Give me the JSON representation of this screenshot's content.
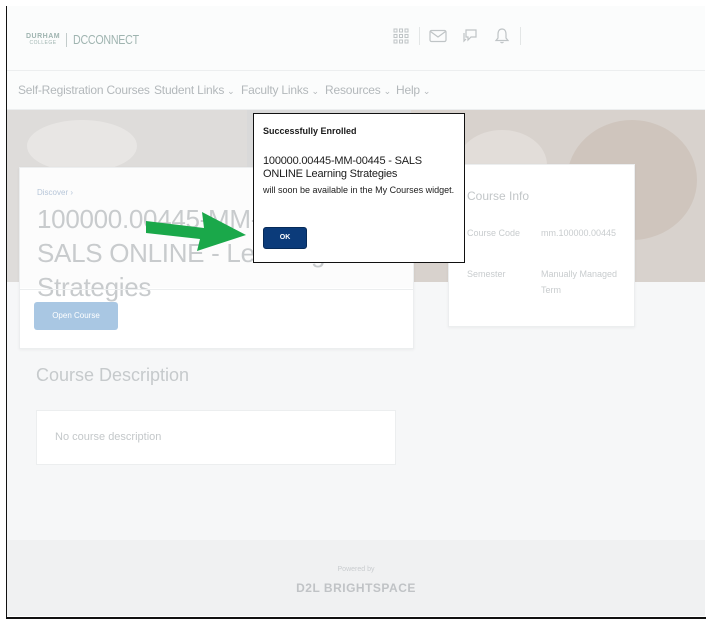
{
  "header": {
    "logo_top": "DURHAM",
    "logo_bottom": "COLLEGE",
    "logo_brand": "DCCONNECT"
  },
  "nav": {
    "items": [
      {
        "label": "Self-Registration Courses",
        "dropdown": false
      },
      {
        "label": "Student Links",
        "dropdown": true
      },
      {
        "label": "Faculty Links",
        "dropdown": true
      },
      {
        "label": "Resources",
        "dropdown": true
      },
      {
        "label": "Help",
        "dropdown": true
      }
    ]
  },
  "course": {
    "breadcrumb": "Discover ›",
    "title": "100000.00445-MM-00445 - SALS ONLINE - Learning Strategies",
    "open_button": "Open Course"
  },
  "info": {
    "title": "Course Info",
    "code_label": "Course Code",
    "code_value": "mm.100000.00445",
    "semester_label": "Semester",
    "semester_value": "Manually Managed Term"
  },
  "description": {
    "heading": "Course Description",
    "text": "No course description"
  },
  "footer": {
    "powered_by": "Powered by",
    "brand": "D2L BRIGHTSPACE"
  },
  "dialog": {
    "title": "Successfully Enrolled",
    "course_line": "100000.00445-MM-00445 - SALS ONLINE   Learning Strategies",
    "message": "will soon be available in the My Courses widget.",
    "ok_label": "OK"
  },
  "colors": {
    "ok_button": "#0b3b7a",
    "open_button": "#a9c7e3",
    "arrow": "#1aa84a"
  }
}
